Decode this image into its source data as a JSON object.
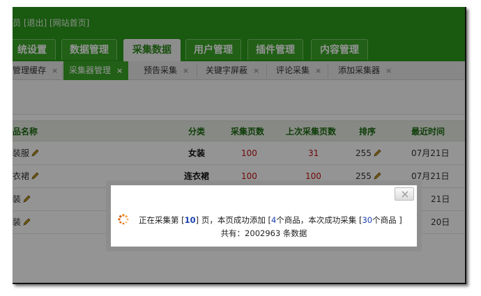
{
  "header": {
    "user_text": "员 [退出] [网站首页]"
  },
  "nav": {
    "tabs": [
      {
        "label": "统设置"
      },
      {
        "label": "数据管理"
      },
      {
        "label": "采集数据"
      },
      {
        "label": "用户管理"
      },
      {
        "label": "插件管理"
      },
      {
        "label": "内容管理"
      }
    ],
    "active_index": 2
  },
  "subnav": {
    "tabs": [
      {
        "label": "管理缓存",
        "close": "×"
      },
      {
        "label": "采集器管理",
        "close": "×"
      },
      {
        "label": "预告采集",
        "close": "×"
      },
      {
        "label": "关键字屏蔽",
        "close": "×"
      },
      {
        "label": "评论采集",
        "close": "×"
      },
      {
        "label": "添加采集器",
        "close": "×"
      }
    ],
    "active_index": 1
  },
  "table": {
    "headers": {
      "name": "品名称",
      "category": "分类",
      "pages": "采集页数",
      "last_pages": "上次采集页数",
      "order": "排序",
      "recent_time": "最近时间"
    },
    "rows": [
      {
        "name": "装服",
        "category": "女装",
        "pages": "100",
        "last_pages": "31",
        "order": "255",
        "time": "07月21日"
      },
      {
        "name": "衣裙",
        "category": "连衣裙",
        "pages": "100",
        "last_pages": "100",
        "order": "255",
        "time": "07月21日"
      },
      {
        "name": "装",
        "category": "",
        "pages": "",
        "last_pages": "",
        "order": "",
        "time": "21日"
      },
      {
        "name": "装",
        "category": "",
        "pages": "",
        "last_pages": "",
        "order": "",
        "time": "20日"
      }
    ]
  },
  "dialog": {
    "msg_prefix": "正在采集第 [",
    "page_num": "10",
    "msg_mid1": "] 页，本页成功添加 [",
    "added_count": "4",
    "msg_mid2": "个商品，本次成功采集 [",
    "total_collected": "30",
    "msg_suffix": "个商品 ]",
    "total_line": "共有：2002963 条数据"
  },
  "colors": {
    "brand_green": "#2c9a1c",
    "active_tab_green": "#3aa527",
    "header_text_green": "#1a6a10",
    "number_red": "#c01010",
    "highlight_blue": "#1a3fb0",
    "spinner_orange": "#f08a1a"
  }
}
